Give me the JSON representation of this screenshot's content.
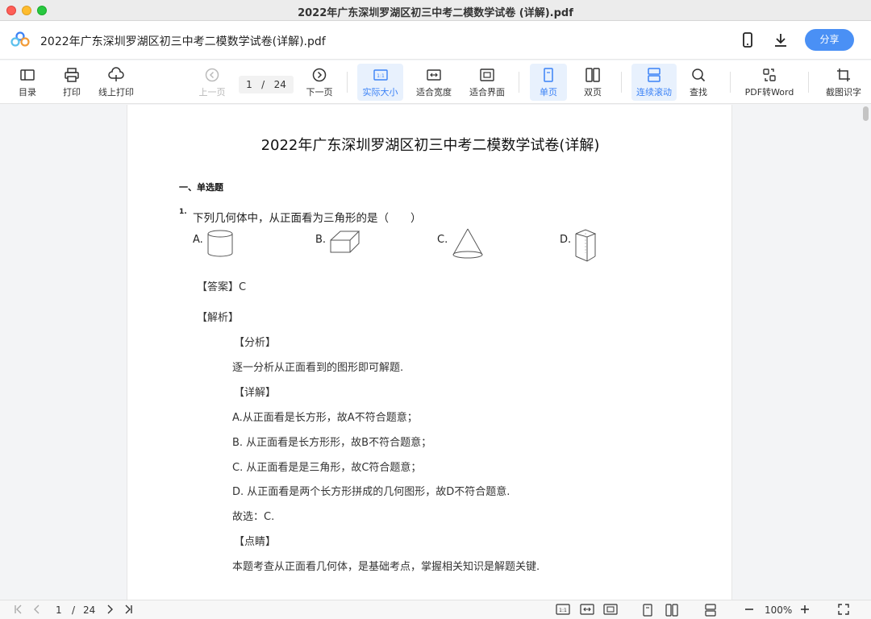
{
  "window": {
    "title": "2022年广东深圳罗湖区初三中考二模数学试卷 (详解).pdf"
  },
  "header": {
    "doc_title": "2022年广东深圳罗湖区初三中考二模数学试卷(详解).pdf",
    "share_label": "分享"
  },
  "toolbar": {
    "toc": "目录",
    "print": "打印",
    "online_print": "线上打印",
    "prev_page": "上一页",
    "page_current": "1",
    "page_sep": "/",
    "page_total": "24",
    "next_page": "下一页",
    "actual_size": "实际大小",
    "fit_width": "适合宽度",
    "fit_page": "适合界面",
    "single_page": "单页",
    "double_page": "双页",
    "continuous_scroll": "连续滚动",
    "find": "查找",
    "pdf_to_word": "PDF转Word",
    "ocr": "截图识字",
    "actual_size_badge": "1:1"
  },
  "document": {
    "title": "2022年广东深圳罗湖区初三中考二模数学试卷(详解)",
    "section": "一、单选题",
    "q_number": "1.",
    "q_text": "下列几何体中，从正面看为三角形的是（　　）",
    "options": [
      {
        "label": "A.",
        "shape": "cylinder"
      },
      {
        "label": "B.",
        "shape": "cuboid"
      },
      {
        "label": "C.",
        "shape": "cone"
      },
      {
        "label": "D.",
        "shape": "triangular-prism"
      }
    ],
    "answer": "【答案】C",
    "analysis_title": "【解析】",
    "analysis_head": "【分析】",
    "analysis_text": "逐一分析从正面看到的图形即可解题.",
    "detail_head": "【详解】",
    "detail_lines": [
      "A.从正面看是长方形，故A不符合题意；",
      "B. 从正面看是长方形形，故B不符合题意；",
      "C. 从正面看是是三角形，故C符合题意；",
      "D. 从正面看是两个长方形拼成的几何图形，故D不符合题意."
    ],
    "choice": "故选：C.",
    "comment_head": "【点睛】",
    "comment_text": "本题考查从正面看几何体，是基础考点，掌握相关知识是解题关键."
  },
  "bottombar": {
    "page_current": "1",
    "page_sep": "/",
    "page_total": "24",
    "zoom": "100%",
    "actual_badge": "1:1"
  }
}
